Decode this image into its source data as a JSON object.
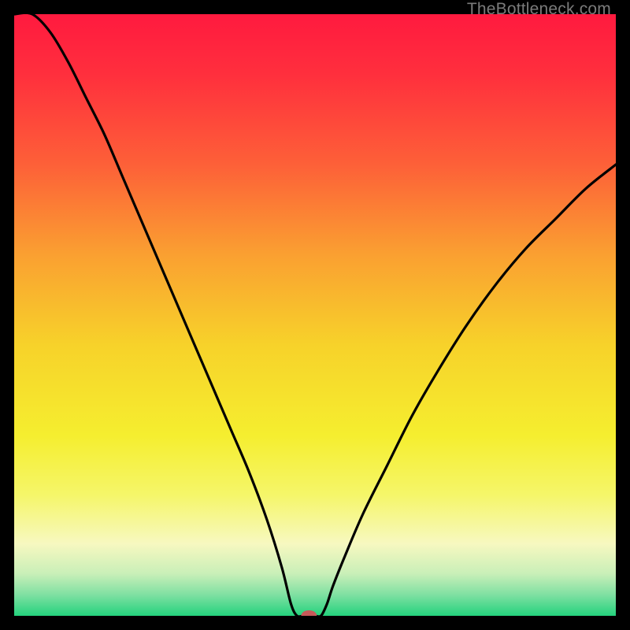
{
  "watermark": "TheBottleneck.com",
  "chart_data": {
    "type": "line",
    "title": "",
    "xlabel": "",
    "ylabel": "",
    "xlim": [
      0,
      100
    ],
    "ylim": [
      0,
      100
    ],
    "grid": false,
    "series": [
      {
        "name": "bottleneck-curve",
        "x": [
          0,
          3,
          6,
          9,
          12,
          15,
          18,
          21,
          24,
          27,
          30,
          33,
          36,
          39,
          42,
          44.5,
          46,
          47,
          48,
          49,
          50,
          51,
          52,
          53,
          55,
          58,
          62,
          66,
          70,
          75,
          80,
          85,
          90,
          95,
          100
        ],
        "y": [
          100,
          100,
          97,
          92,
          86,
          80,
          73,
          66,
          59,
          52,
          45,
          38,
          31,
          24,
          16,
          8,
          2,
          0,
          0,
          0,
          0,
          0,
          2,
          5,
          10,
          17,
          25,
          33,
          40,
          48,
          55,
          61,
          66,
          71,
          75
        ]
      }
    ],
    "marker": {
      "name": "optimal-point",
      "x": 49,
      "y": 0,
      "color": "#c75a5a",
      "rx": 10,
      "ry": 7
    },
    "background_gradient": {
      "stops": [
        {
          "pos": 0.0,
          "color": "#ff1a3f"
        },
        {
          "pos": 0.1,
          "color": "#ff2f3d"
        },
        {
          "pos": 0.25,
          "color": "#fd6038"
        },
        {
          "pos": 0.4,
          "color": "#faa031"
        },
        {
          "pos": 0.55,
          "color": "#f7d22a"
        },
        {
          "pos": 0.7,
          "color": "#f5ee2f"
        },
        {
          "pos": 0.8,
          "color": "#f5f66a"
        },
        {
          "pos": 0.88,
          "color": "#f7f8c0"
        },
        {
          "pos": 0.93,
          "color": "#c9efb8"
        },
        {
          "pos": 0.965,
          "color": "#7fe0a2"
        },
        {
          "pos": 1.0,
          "color": "#24d27d"
        }
      ]
    }
  }
}
